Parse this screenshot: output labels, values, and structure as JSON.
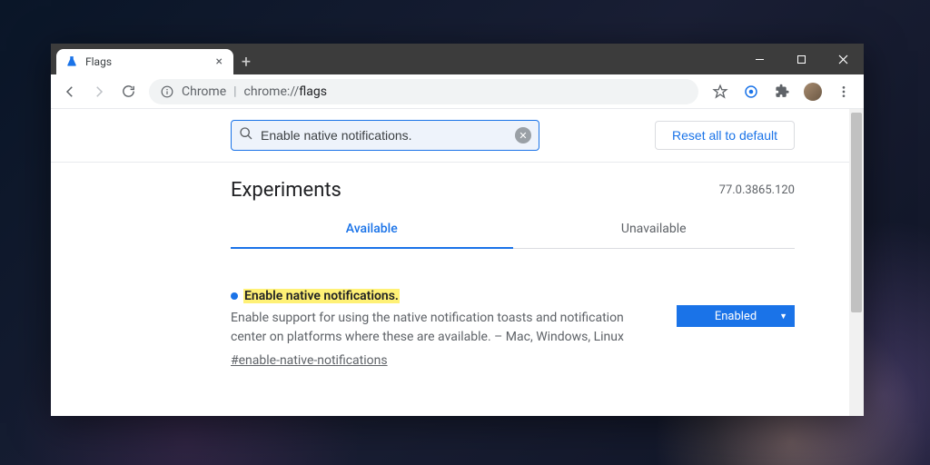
{
  "tab": {
    "title": "Flags"
  },
  "omnibox": {
    "scheme_label": "Chrome",
    "path": "chrome://",
    "path_bold": "flags"
  },
  "search": {
    "value": "Enable native notifications."
  },
  "buttons": {
    "reset": "Reset all to default"
  },
  "header": {
    "title": "Experiments",
    "version": "77.0.3865.120"
  },
  "tabs": {
    "available": "Available",
    "unavailable": "Unavailable"
  },
  "flag": {
    "title": "Enable native notifications.",
    "description": "Enable support for using the native notification toasts and notification center on platforms where these are available. – Mac, Windows, Linux",
    "hash": "#enable-native-notifications",
    "state": "Enabled"
  }
}
